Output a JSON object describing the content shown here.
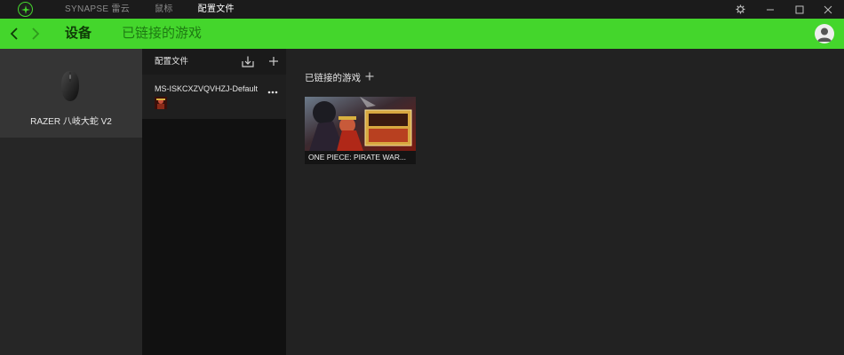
{
  "titlebar": {
    "nav": [
      {
        "label": "SYNAPSE 雷云",
        "active": false
      },
      {
        "label": "鼠标",
        "active": false
      },
      {
        "label": "配置文件",
        "active": true
      }
    ],
    "icons": [
      "razer-logo-icon",
      "settings-icon",
      "minimize-icon",
      "maximize-icon",
      "close-icon"
    ]
  },
  "header": {
    "devices_label": "设备",
    "linked_games_label": "已链接的游戏",
    "accent_color": "#44d62c"
  },
  "device": {
    "name": "RAZER 八岐大蛇 V2"
  },
  "profiles": {
    "title": "配置文件",
    "items": [
      {
        "name": "MS-ISKCXZVQVHZJ-Default"
      }
    ]
  },
  "linked_games": {
    "title": "已链接的游戏",
    "games": [
      {
        "name": "ONE PIECE: PIRATE WAR..."
      }
    ]
  }
}
